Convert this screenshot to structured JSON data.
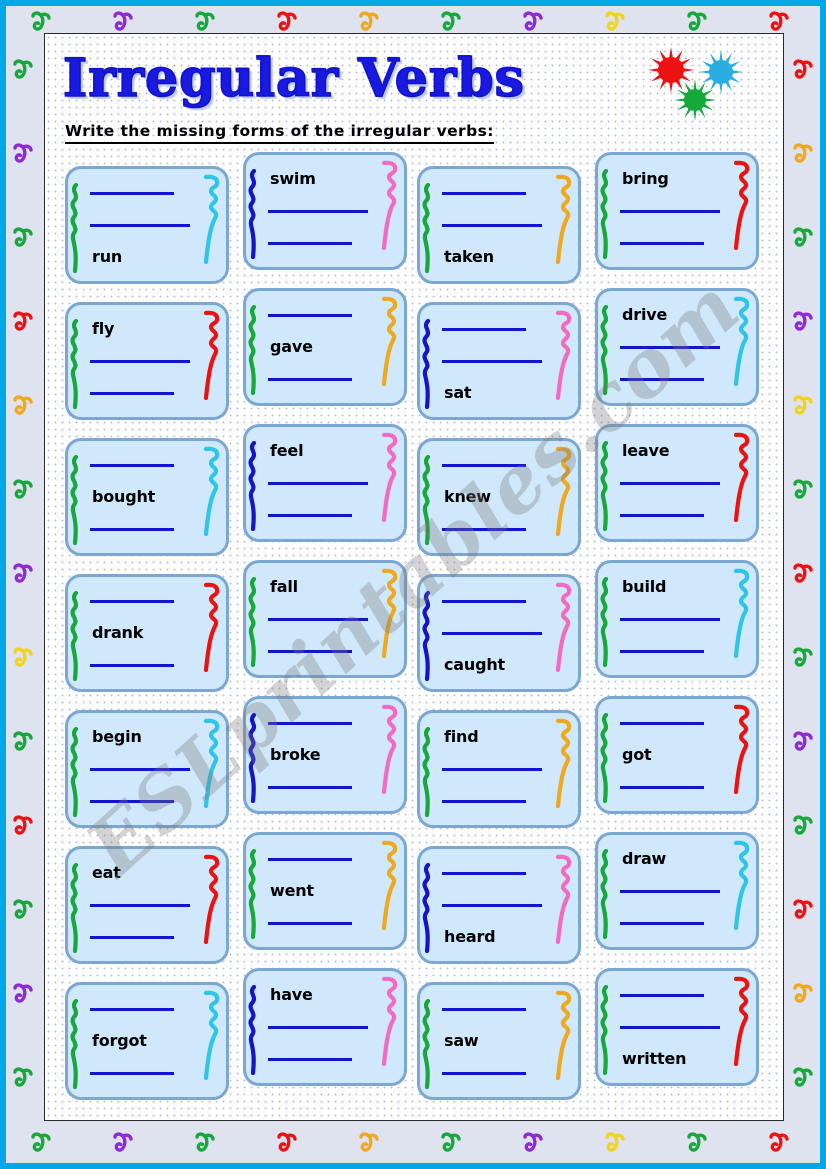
{
  "page": {
    "title": "Irregular Verbs",
    "instruction": "Write the missing forms of the irregular verbs:",
    "watermark": "ESLprintables.com"
  },
  "colors": {
    "outer_frame": "#00a8e8",
    "border_band": "#dfe3f0",
    "paper": "#ffffff",
    "title_text": "#1919e0",
    "card_fill": "#cfe8fb",
    "card_border": "#7ba7d0",
    "blank_line": "#1414c8",
    "word_text": "#000000"
  },
  "decorations": {
    "bursts": [
      {
        "name": "starburst-red",
        "color": "#ee1111"
      },
      {
        "name": "starburst-blue",
        "color": "#2aaee0"
      },
      {
        "name": "starburst-green",
        "color": "#16a83a"
      }
    ],
    "border_curl_colors": [
      "#16a83a",
      "#8e2bd4",
      "#16a83a",
      "#ee1111",
      "#f0a81e",
      "#16a83a",
      "#8e2bd4",
      "#f0d41e",
      "#16a83a",
      "#ee1111"
    ]
  },
  "cards": [
    {
      "word": "run",
      "line": 3,
      "left_vine": "#16a83a",
      "right_vine": "#2ec5e8"
    },
    {
      "word": "swim",
      "line": 1,
      "left_vine": "#1414c8",
      "right_vine": "#f56ac0"
    },
    {
      "word": "taken",
      "line": 3,
      "left_vine": "#16a83a",
      "right_vine": "#f0a81e"
    },
    {
      "word": "bring",
      "line": 1,
      "left_vine": "#16a83a",
      "right_vine": "#ee1111"
    },
    {
      "word": "fly",
      "line": 1,
      "left_vine": "#16a83a",
      "right_vine": "#ee1111"
    },
    {
      "word": "gave",
      "line": 2,
      "left_vine": "#16a83a",
      "right_vine": "#f0a81e"
    },
    {
      "word": "sat",
      "line": 3,
      "left_vine": "#1414c8",
      "right_vine": "#f56ac0"
    },
    {
      "word": "drive",
      "line": 1,
      "left_vine": "#16a83a",
      "right_vine": "#2ec5e8"
    },
    {
      "word": "bought",
      "line": 2,
      "left_vine": "#16a83a",
      "right_vine": "#2ec5e8"
    },
    {
      "word": "feel",
      "line": 1,
      "left_vine": "#1414c8",
      "right_vine": "#f56ac0"
    },
    {
      "word": "knew",
      "line": 2,
      "left_vine": "#16a83a",
      "right_vine": "#f0a81e"
    },
    {
      "word": "leave",
      "line": 1,
      "left_vine": "#16a83a",
      "right_vine": "#ee1111"
    },
    {
      "word": "drank",
      "line": 2,
      "left_vine": "#16a83a",
      "right_vine": "#ee1111"
    },
    {
      "word": "fall",
      "line": 1,
      "left_vine": "#16a83a",
      "right_vine": "#f0a81e"
    },
    {
      "word": "caught",
      "line": 3,
      "left_vine": "#1414c8",
      "right_vine": "#f56ac0"
    },
    {
      "word": "build",
      "line": 1,
      "left_vine": "#16a83a",
      "right_vine": "#2ec5e8"
    },
    {
      "word": "begin",
      "line": 1,
      "left_vine": "#16a83a",
      "right_vine": "#2ec5e8"
    },
    {
      "word": "broke",
      "line": 2,
      "left_vine": "#1414c8",
      "right_vine": "#f56ac0"
    },
    {
      "word": "find",
      "line": 1,
      "left_vine": "#16a83a",
      "right_vine": "#f0a81e"
    },
    {
      "word": "got",
      "line": 2,
      "left_vine": "#16a83a",
      "right_vine": "#ee1111"
    },
    {
      "word": "eat",
      "line": 1,
      "left_vine": "#16a83a",
      "right_vine": "#ee1111"
    },
    {
      "word": "went",
      "line": 2,
      "left_vine": "#16a83a",
      "right_vine": "#f0a81e"
    },
    {
      "word": "heard",
      "line": 3,
      "left_vine": "#1414c8",
      "right_vine": "#f56ac0"
    },
    {
      "word": "draw",
      "line": 1,
      "left_vine": "#16a83a",
      "right_vine": "#2ec5e8"
    },
    {
      "word": "forgot",
      "line": 2,
      "left_vine": "#16a83a",
      "right_vine": "#2ec5e8"
    },
    {
      "word": "have",
      "line": 1,
      "left_vine": "#1414c8",
      "right_vine": "#f56ac0"
    },
    {
      "word": "saw",
      "line": 2,
      "left_vine": "#16a83a",
      "right_vine": "#f0a81e"
    },
    {
      "word": "written",
      "line": 3,
      "left_vine": "#16a83a",
      "right_vine": "#ee1111"
    }
  ]
}
